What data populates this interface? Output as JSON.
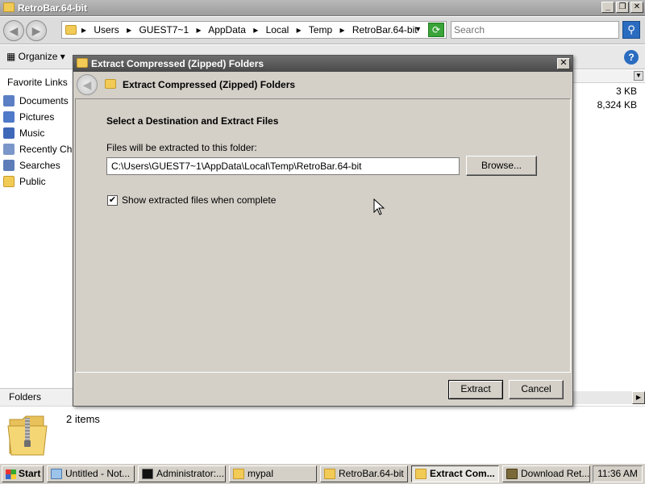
{
  "explorer": {
    "title": "RetroBar.64-bit",
    "breadcrumbs": [
      "Users",
      "GUEST7~1",
      "AppData",
      "Local",
      "Temp",
      "RetroBar.64-bit"
    ],
    "search_placeholder": "Search",
    "toolbar": {
      "organize": "Organize"
    },
    "sidebar": {
      "header": "Favorite Links",
      "items": [
        {
          "label": "Documents",
          "icon": "documents-icon"
        },
        {
          "label": "Pictures",
          "icon": "pictures-icon"
        },
        {
          "label": "Music",
          "icon": "music-icon"
        },
        {
          "label": "Recently Cha",
          "icon": "recent-icon"
        },
        {
          "label": "Searches",
          "icon": "searches-icon"
        },
        {
          "label": "Public",
          "icon": "public-folder-icon"
        }
      ],
      "folders_label": "Folders"
    },
    "files": {
      "sizes": [
        "3 KB",
        "8,324 KB"
      ]
    },
    "details": {
      "count": "2 items"
    }
  },
  "dialog": {
    "title": "Extract Compressed (Zipped) Folders",
    "header": "Extract Compressed (Zipped) Folders",
    "section_heading": "Select a Destination and Extract Files",
    "path_label": "Files will be extracted to this folder:",
    "path_value": "C:\\Users\\GUEST7~1\\AppData\\Local\\Temp\\RetroBar.64-bit",
    "browse_label": "Browse...",
    "checkbox_label": "Show extracted files when complete",
    "checkbox_checked": true,
    "extract_label": "Extract",
    "cancel_label": "Cancel"
  },
  "taskbar": {
    "start_label": "Start",
    "tasks": [
      {
        "label": "Untitled - Not...",
        "icon": "notepad-icon"
      },
      {
        "label": "Administrator:...",
        "icon": "cmd-icon"
      },
      {
        "label": "mypal",
        "icon": "folder-icon"
      },
      {
        "label": "RetroBar.64-bit",
        "icon": "folder-icon"
      },
      {
        "label": "Extract Com...",
        "icon": "folder-icon",
        "active": true
      },
      {
        "label": "Download Ret...",
        "icon": "browser-icon"
      }
    ],
    "clock": "11:36 AM"
  }
}
